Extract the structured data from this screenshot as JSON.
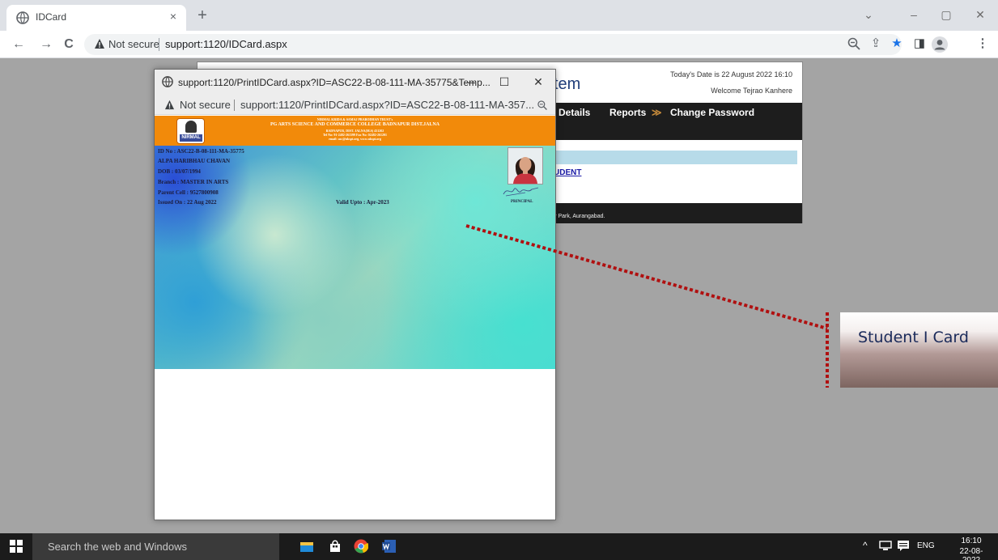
{
  "browser": {
    "tab_title": "IDCard",
    "tab_close": "×",
    "new_tab": "+",
    "not_secure": "Not secure",
    "url": "support:1120/IDCard.aspx",
    "nav": {
      "back": "←",
      "forward": "→",
      "reload": "C"
    },
    "window_controls": {
      "chevron": "⌄",
      "minimize": "–",
      "restore": "▢",
      "close": "✕"
    },
    "toolbar_icons": {
      "share": "⇪",
      "bookmark": "★",
      "sidepanel": "◨",
      "menu": "⋮"
    }
  },
  "erp": {
    "system_title": "tem",
    "date_text": "Today's Date is 22 August 2022 16:10",
    "welcome_text": "Welcome Tejrao Kanhere",
    "menu": {
      "details": "Details",
      "reports": "Reports",
      "reports_chevron": "≫",
      "change_password": "Change Password"
    },
    "student_link": "UDENT",
    "footer_dot": ".",
    "footer_address": "y Park, Aurangabad."
  },
  "popup": {
    "title": "support:1120/PrintIDCard.aspx?ID=ASC22-B-08-111-MA-35775&Temp...",
    "not_secure": "Not secure",
    "url": "support:1120/PrintIDCard.aspx?ID=ASC22-B-08-111-MA-357...",
    "controls": {
      "minimize": "—",
      "maximize": "☐",
      "close": "✕"
    }
  },
  "card": {
    "logo_text": "NIRMAL",
    "trust": "NIRMAL KRIDA & SAMAJ PRABODHAN TRUST's",
    "college": "PG ARTS SCIENCE AND COMMERCE COLLEGE BADNAPUR DIST.JALNA",
    "address": "BADNAPUR, DIST. JALNA(M.S) 431202",
    "tel": "Tel No: 91-2482-261599 Fax No: 02482-261201",
    "email": "email: asc@nkspt.org, www.nkspt.org",
    "id_no": "ID No : ASC22-B-08-111-MA-35775",
    "name": "ALPA HARIBHAU CHAVAN",
    "dob": "DOB : 03/07/1994",
    "branch": "Branch : MASTER IN ARTS",
    "parent_cell": "Parent Cell : 9527800908",
    "issued_on": "Issued On : 22 Aug 2022",
    "valid_upto": "Valid Upto : Apr-2023",
    "principal": "PRINCIPAL"
  },
  "annotation": {
    "label": "Student I Card",
    "line_color": "#b01010"
  },
  "taskbar": {
    "search_placeholder": "Search the web and Windows",
    "tray_up": "^",
    "lang": "ENG",
    "time": "16:10",
    "date": "22-08-2022"
  }
}
